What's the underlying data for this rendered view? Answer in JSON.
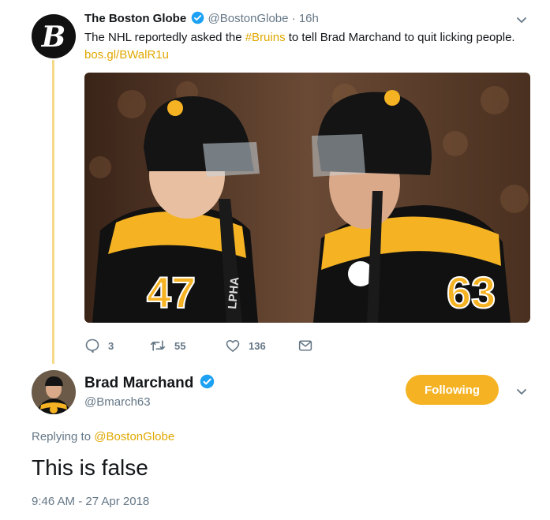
{
  "parent_tweet": {
    "author_name": "The Boston Globe",
    "handle": "@BostonGlobe",
    "separator": "·",
    "time": "16h",
    "text_before": "The NHL reportedly asked the ",
    "hashtag": "#Bruins",
    "text_after": " to tell Brad Marchand to quit licking people. ",
    "link": "bos.gl/BWalR1u",
    "jersey_left_number": "47",
    "jersey_right_number": "63",
    "stick_text": "LPHA",
    "actions": {
      "replies": "3",
      "retweets": "55",
      "likes": "136"
    }
  },
  "reply_tweet": {
    "author_name": "Brad Marchand",
    "handle": "@Bmarch63",
    "follow_label": "Following",
    "replying_prefix": "Replying to ",
    "replying_handle": "@BostonGlobe",
    "text": "This is false",
    "timestamp": "9:46 AM - 27 Apr 2018"
  },
  "colors": {
    "accent": "#e0a800",
    "follow_button": "#f5b323",
    "verified": "#1da1f2",
    "muted": "#657786"
  },
  "icons": [
    "verified-icon",
    "chevron-down-icon",
    "reply-icon",
    "retweet-icon",
    "like-icon",
    "message-icon",
    "globe-logo-icon"
  ]
}
